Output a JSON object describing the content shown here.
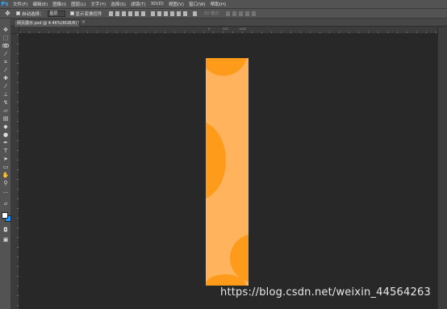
{
  "app": {
    "logo_text": "Ps"
  },
  "menu": [
    "文件(F)",
    "编辑(E)",
    "图像(I)",
    "图层(L)",
    "文字(Y)",
    "选择(S)",
    "滤镜(T)",
    "3D(D)",
    "视图(V)",
    "窗口(W)",
    "帮助(H)"
  ],
  "options_bar": {
    "auto_select_label": "自动选择：",
    "auto_select_value": "图层",
    "show_transform_label": "显示变换控件",
    "mode_3d_label": "3D 模式："
  },
  "document": {
    "tab_title": "网页展示.psd @ 4.46%(RGB/8) *",
    "close_glyph": "×",
    "background_color": "#ffb35c",
    "shape_color": "#ff9b1a"
  },
  "colors": {
    "foreground": "#ffffff",
    "background": "#1e90ff"
  },
  "ruler_labels": [
    "0",
    "500",
    "1000"
  ],
  "watermark": "https://blog.csdn.net/weixin_44564263"
}
